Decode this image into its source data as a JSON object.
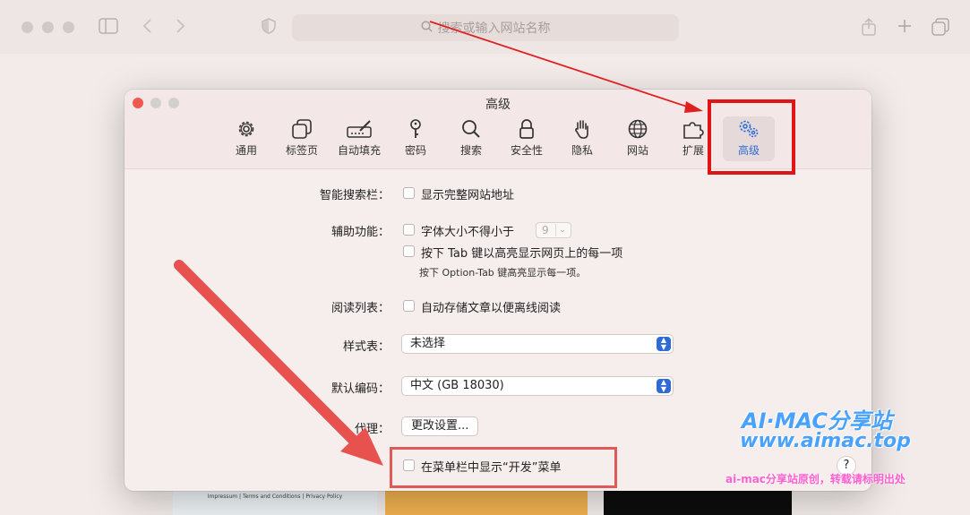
{
  "browser": {
    "address_placeholder": "搜索或输入网站名称"
  },
  "page_strip": {
    "footer_text": "Impressum | Terms and Conditions | Privacy Policy"
  },
  "prefs": {
    "title": "高级",
    "tabs": [
      {
        "label": "通用",
        "icon": "gear-icon"
      },
      {
        "label": "标签页",
        "icon": "tabs-icon"
      },
      {
        "label": "自动填充",
        "icon": "pencil-field-icon"
      },
      {
        "label": "密码",
        "icon": "key-icon"
      },
      {
        "label": "搜索",
        "icon": "magnifier-icon"
      },
      {
        "label": "安全性",
        "icon": "lock-icon"
      },
      {
        "label": "隐私",
        "icon": "hand-icon"
      },
      {
        "label": "网站",
        "icon": "globe-icon"
      },
      {
        "label": "扩展",
        "icon": "puzzle-icon"
      },
      {
        "label": "高级",
        "icon": "gears-icon"
      }
    ],
    "active_tab": "高级",
    "smart_search": {
      "label": "智能搜索栏：",
      "option": "显示完整网站地址",
      "checked": false
    },
    "accessibility": {
      "label": "辅助功能：",
      "min_font_option": "字体大小不得小于",
      "min_font_value": "9",
      "tab_option": "按下 Tab 键以高亮显示网页上的每一项",
      "tab_hint": "按下 Option-Tab 键高亮显示每一项。",
      "checked_min_font": false,
      "checked_tab": false
    },
    "reading_list": {
      "label": "阅读列表：",
      "option": "自动存储文章以便离线阅读",
      "checked": false
    },
    "stylesheet": {
      "label": "样式表：",
      "value": "未选择"
    },
    "encoding": {
      "label": "默认编码：",
      "value": "中文 (GB 18030)"
    },
    "proxy": {
      "label": "代理：",
      "button": "更改设置..."
    },
    "develop_menu": {
      "option": "在菜单栏中显示“开发”菜单",
      "checked": false
    },
    "help_label": "?"
  },
  "watermark": {
    "line1": "AI·MAC分享站",
    "line2": "www.aimac.top",
    "line3": "ai-mac分享站原创，转载请标明出处"
  },
  "colors": {
    "accent": "#2f6bd8",
    "highlight_red": "#e01515",
    "arrow_red": "#e8524e"
  }
}
